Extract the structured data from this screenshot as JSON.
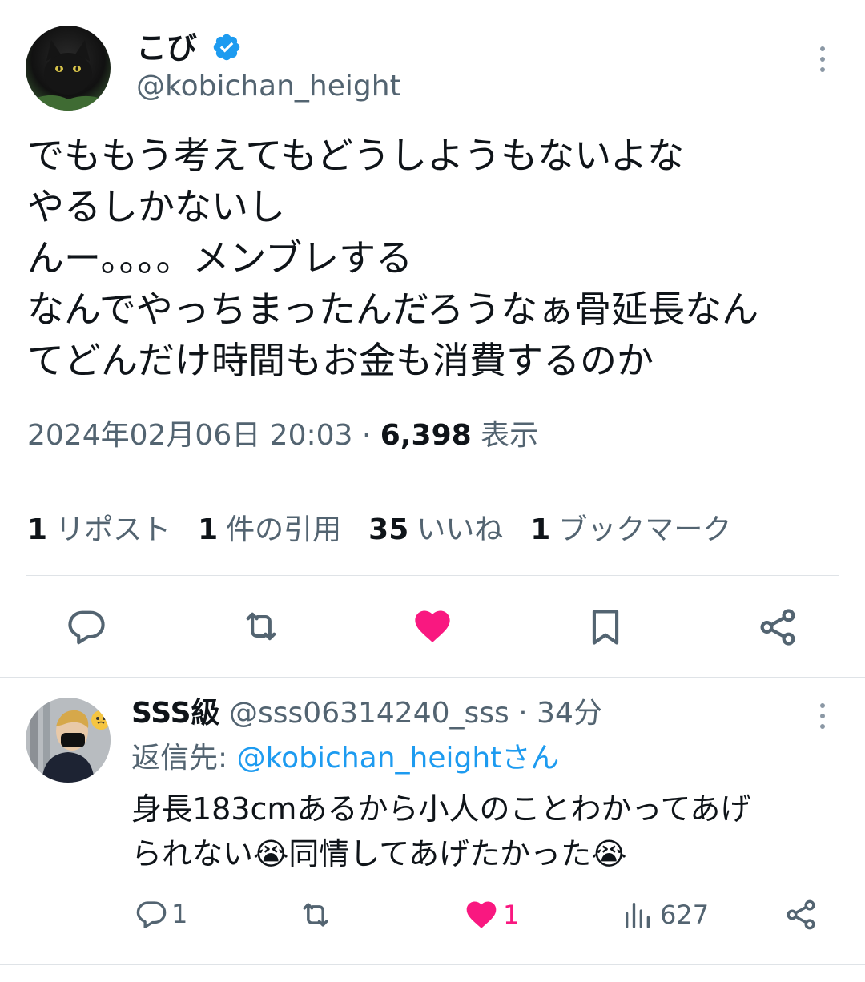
{
  "tweet": {
    "author_name": "こび",
    "author_handle": "@kobichan_height",
    "text_lines": [
      "でももう考えてもどうしようもないよな",
      "やるしかないし",
      "んー。。。。メンブレする",
      "なんでやっちまったんだろうなぁ骨延長なん",
      "てどんだけ時間もお金も消費するのか"
    ],
    "datetime": "2024年02月06日 20:03",
    "separator": "·",
    "views_count": "6,398",
    "views_label": "表示",
    "stats": [
      {
        "count": "1",
        "label": "リポスト"
      },
      {
        "count": "1",
        "label": "件の引用"
      },
      {
        "count": "35",
        "label": "いいね"
      },
      {
        "count": "1",
        "label": "ブックマーク"
      }
    ],
    "accent_blue": "#1d9bf0",
    "like_color": "#f91880",
    "icon_color": "#536471"
  },
  "reply": {
    "author_name": "SSS級",
    "author_handle": "@sss06314240_sss",
    "separator": "·",
    "time": "34分",
    "reply_to_label": "返信先:",
    "reply_to_handle": "@kobichan_heightさん",
    "text_lines": [
      "身長183cmあるから小人のことわかってあげ",
      "られない😭同情してあげたかった😭"
    ],
    "reply_count": "1",
    "like_count": "1",
    "views_count": "627"
  }
}
